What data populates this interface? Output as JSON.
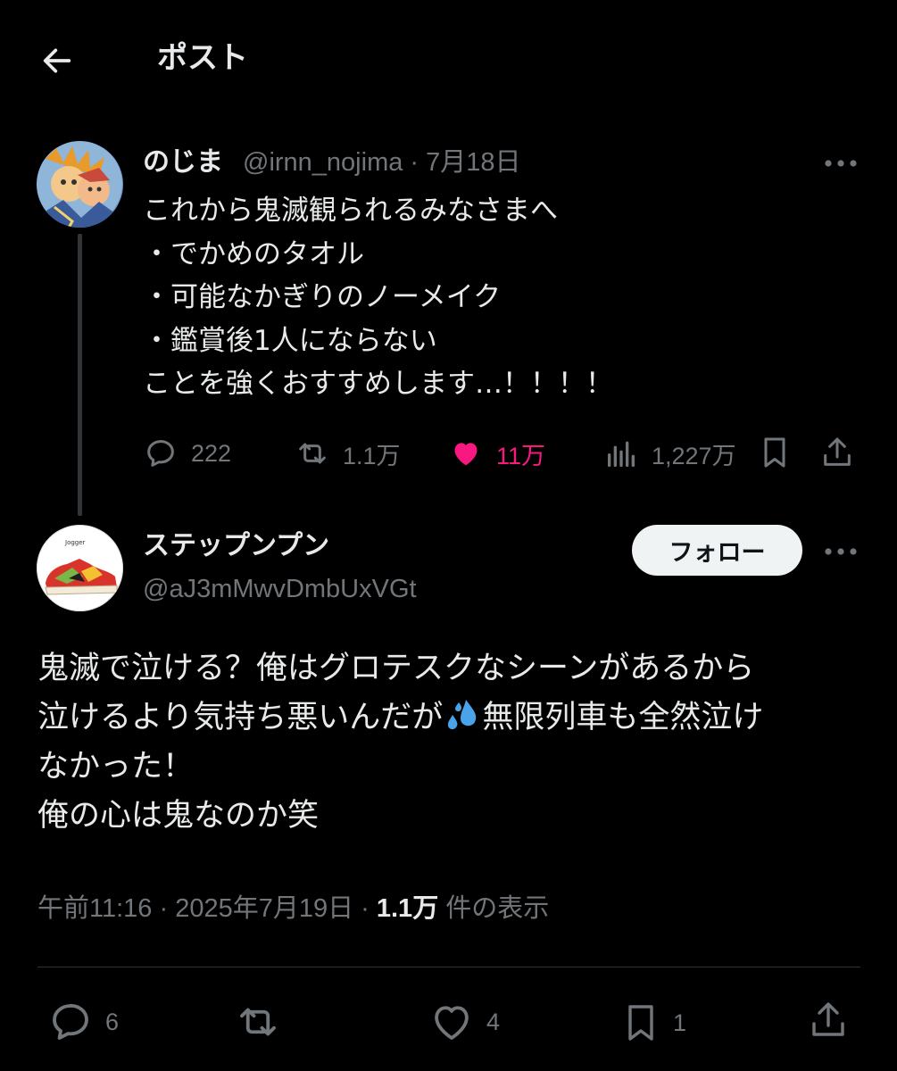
{
  "header": {
    "title": "ポスト",
    "back_icon": "arrow-left-icon"
  },
  "parent_tweet": {
    "display_name": "のじま",
    "meta": "@irnn_nojima · 7月18日",
    "text": "これから鬼滅観られるみなさまへ\n・でかめのタオル\n・可能なかぎりのノーメイク\n・鑑賞後1人にならない\nことを強くおすすめします…！！！！",
    "replies": "222",
    "retweets": "1.1万",
    "likes": "11万",
    "views": "1,227万",
    "like_color": "#f91880"
  },
  "main_tweet": {
    "display_name": "ステップンプン",
    "handle": "@aJ3mMwvDmbUxVGt",
    "follow_label": "フォロー",
    "avatar_label": "Jogger",
    "body": {
      "line1": "鬼滅で泣ける？俺はグロテスクなシーンがあるから",
      "line2a": "泣けるより気持ち悪いんだが",
      "line2b": "無限列車も全然泣け",
      "line3": "なかった！",
      "line4": "俺の心は鬼なのか笑"
    },
    "emoji": "sweat-droplets-emoji",
    "time": "午前11:16 · 2025年7月19日 · ",
    "views": "1.1万",
    "views_suffix": " 件の表示",
    "replies": "6",
    "retweets": "",
    "likes": "4",
    "bookmarks": "1"
  },
  "colors": {
    "background": "#000000",
    "text": "#e7e9ea",
    "secondary": "#71767b",
    "divider": "#2f3336"
  }
}
